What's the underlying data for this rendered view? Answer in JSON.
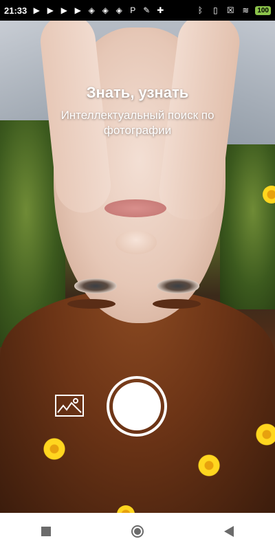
{
  "status_bar": {
    "time": "21:33",
    "left_icons": [
      "play-store-icon",
      "play-store-icon",
      "play-store-icon",
      "play-store-icon",
      "photo-app-icon",
      "photo-app-icon",
      "photo-app-icon",
      "p-icon",
      "tools-icon",
      "gamepad-icon"
    ],
    "right_icons": [
      "bluetooth-icon",
      "vibrate-icon",
      "notification-icon",
      "wifi-icon"
    ],
    "battery": "100",
    "battery_color": "#8bc34a"
  },
  "header": {
    "title": "Знать, узнать",
    "subtitle": "Интеллектуальный поиск по фотографии"
  },
  "camera": {
    "gallery_icon": "image-icon",
    "shutter_icon": "shutter-icon"
  },
  "navigation": {
    "buttons": [
      "stop-square-icon",
      "home-circle-icon",
      "back-triangle-icon"
    ]
  }
}
